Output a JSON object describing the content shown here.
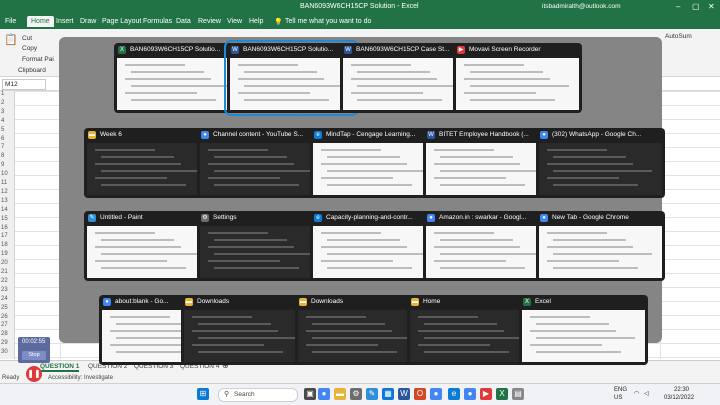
{
  "excel": {
    "title": "BAN6093W6CH15CP Solution  -  Excel",
    "account": "itsbadmiralth@outlook.com",
    "menu": [
      "File",
      "Home",
      "Insert",
      "Draw",
      "Page Layout",
      "Formulas",
      "Data",
      "Review",
      "View",
      "Help"
    ],
    "tell_me": "Tell me what you want to do",
    "ribbon": {
      "cut": "Cut",
      "copy": "Copy",
      "format_painter": "Format Pai",
      "clipboard": "Clipboard",
      "autosum": "AutoSum"
    },
    "name_box": "M12",
    "row_numbers": [
      "1",
      "2",
      "3",
      "4",
      "5",
      "6",
      "7",
      "8",
      "9",
      "10",
      "11",
      "12",
      "13",
      "14",
      "15",
      "16",
      "17",
      "18",
      "19",
      "20",
      "21",
      "22",
      "23",
      "24",
      "25",
      "26",
      "27",
      "28",
      "29",
      "30"
    ],
    "sheet_tabs": [
      "QUESTION 1",
      "QUESTION 2",
      "QUESTION 3",
      "QUESTION 4"
    ],
    "status": {
      "ready": "Ready",
      "accessibility": "Accessibility: Investigate"
    }
  },
  "recorder": {
    "time": "00:02:55",
    "stop": "Stop"
  },
  "windows": [
    {
      "title": "BAN6093W6CH15CP Solutio...",
      "icon": "excel-icon",
      "color": "#217346",
      "preview": "light"
    },
    {
      "title": "BAN6093W6CH15CP Solutio...",
      "icon": "word-icon",
      "color": "#2b579a",
      "preview": "light"
    },
    {
      "title": "BAN6093W6CH15CP Case St...",
      "icon": "word-icon",
      "color": "#2b579a",
      "preview": "light"
    },
    {
      "title": "Movavi Screen Recorder",
      "icon": "movavi-icon",
      "color": "#e0383b",
      "preview": "light"
    },
    {
      "title": "Week 6",
      "icon": "folder-icon",
      "color": "#e8b339",
      "preview": "dark"
    },
    {
      "title": "Channel content - YouTube S...",
      "icon": "chrome-icon",
      "color": "#4285f4",
      "preview": "dark"
    },
    {
      "title": "MindTap - Cengage Learning...",
      "icon": "edge-icon",
      "color": "#0c7cd5",
      "preview": "light"
    },
    {
      "title": "BITET Employee Handbook (...",
      "icon": "word-icon",
      "color": "#2b579a",
      "preview": "light"
    },
    {
      "title": "(302) WhatsApp - Google Ch...",
      "icon": "chrome-icon",
      "color": "#4285f4",
      "preview": "dark"
    },
    {
      "title": "Untitled - Paint",
      "icon": "paint-icon",
      "color": "#2f8fd8",
      "preview": "light"
    },
    {
      "title": "Settings",
      "icon": "gear-icon",
      "color": "#6d6d6d",
      "preview": "dark"
    },
    {
      "title": "Capacity-planning-and-contr...",
      "icon": "edge-icon",
      "color": "#0c7cd5",
      "preview": "light"
    },
    {
      "title": "Amazon.in : swarkar - Googl...",
      "icon": "chrome-icon",
      "color": "#4285f4",
      "preview": "light"
    },
    {
      "title": "New Tab - Google Chrome",
      "icon": "chrome-icon",
      "color": "#4285f4",
      "preview": "light"
    },
    {
      "title": "about:blank - Go...",
      "icon": "chrome-icon",
      "color": "#4285f4",
      "preview": "light"
    },
    {
      "title": "Downloads",
      "icon": "folder-icon",
      "color": "#e8b339",
      "preview": "dark"
    },
    {
      "title": "Downloads",
      "icon": "folder-icon",
      "color": "#e8b339",
      "preview": "dark"
    },
    {
      "title": "Home",
      "icon": "folder-icon",
      "color": "#e8b339",
      "preview": "dark"
    },
    {
      "title": "Excel",
      "icon": "excel-icon",
      "color": "#217346",
      "preview": "light"
    }
  ],
  "taskbar": {
    "search": "Search",
    "tray": {
      "lang1": "ENG",
      "lang2": "US",
      "time": "22:30",
      "date": "03/12/2022"
    }
  },
  "colors": {
    "excel_green": "#217346",
    "selection": "#1e8ad6",
    "overlay": "#808080"
  }
}
